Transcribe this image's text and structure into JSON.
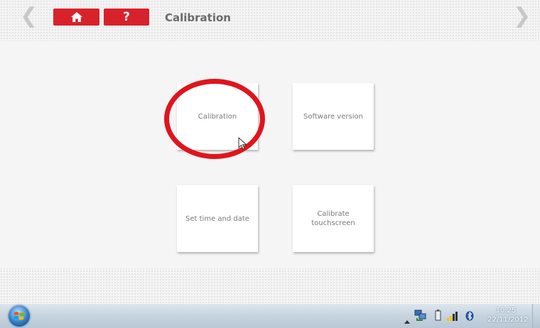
{
  "header": {
    "back_glyph": "❮",
    "forward_glyph": "❯",
    "home_icon": "home-icon",
    "help_label": "?",
    "title": "Calibration",
    "accent_color": "#d8222a"
  },
  "menu": {
    "tiles": [
      {
        "label": "Calibration"
      },
      {
        "label": "Software version"
      },
      {
        "label": "Set time and date"
      },
      {
        "label": "Calibrate\ntouchscreen"
      }
    ],
    "highlight_color": "#e1141c"
  },
  "taskbar": {
    "start_icon": "windows-start-icon",
    "tray_icons": [
      "show-hidden-icons-arrow",
      "network-icon",
      "battery-icon",
      "signal-strength-icon",
      "bluetooth-icon"
    ],
    "clock": {
      "time": "10:25",
      "date": "22/11/2012"
    }
  }
}
